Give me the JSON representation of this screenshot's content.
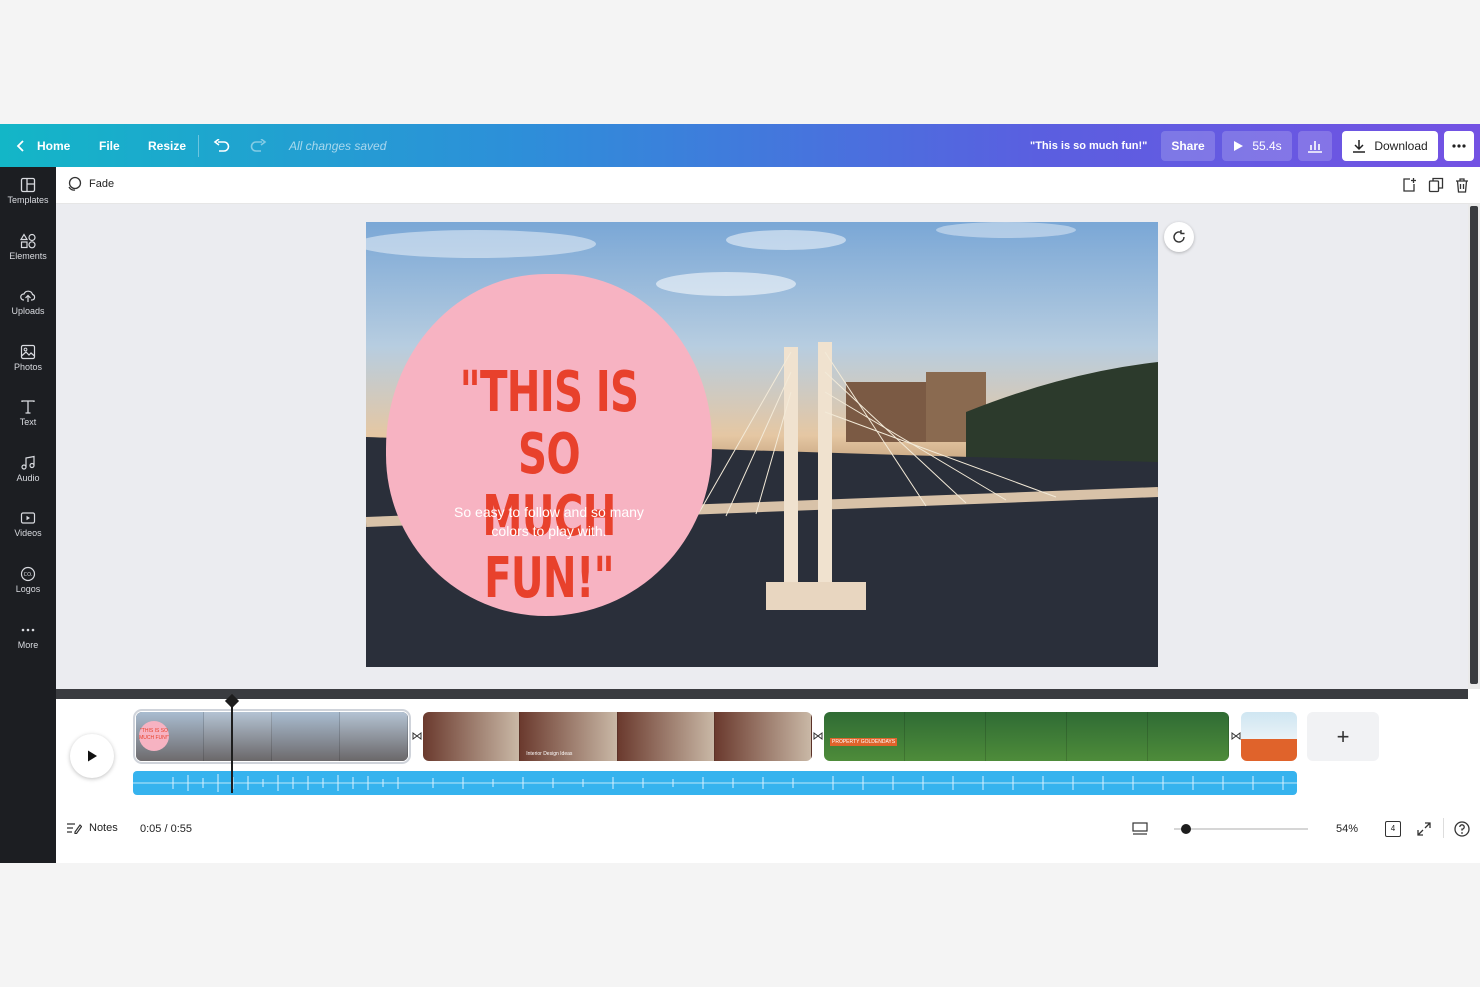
{
  "topbar": {
    "home": "Home",
    "file": "File",
    "resize": "Resize",
    "save_status": "All changes saved",
    "design_title": "\"This is so much fun!\"",
    "share": "Share",
    "duration": "55.4s",
    "download": "Download"
  },
  "sidebar": {
    "items": [
      {
        "label": "Templates",
        "icon": "templates-icon"
      },
      {
        "label": "Elements",
        "icon": "elements-icon"
      },
      {
        "label": "Uploads",
        "icon": "uploads-icon"
      },
      {
        "label": "Photos",
        "icon": "photos-icon"
      },
      {
        "label": "Text",
        "icon": "text-icon"
      },
      {
        "label": "Audio",
        "icon": "audio-icon"
      },
      {
        "label": "Videos",
        "icon": "videos-icon"
      },
      {
        "label": "Logos",
        "icon": "logos-icon"
      },
      {
        "label": "More",
        "icon": "more-icon"
      }
    ]
  },
  "toolbar": {
    "animation": "Fade"
  },
  "slide": {
    "headline_line1": "\"THIS IS SO",
    "headline_line2": "MUCH FUN!\"",
    "subtext": "So easy to follow and so many colors to play with."
  },
  "timeline": {
    "clip1_label": "\"THIS IS SO MUCH FUN!\"",
    "clip2_label": "Interior Design Ideas",
    "clip3_label": "PROPERTY GOLDENDAYS"
  },
  "footer": {
    "notes": "Notes",
    "time": "0:05 / 0:55",
    "zoom": "54%",
    "page_count": "4",
    "zoom_level": 0.09
  },
  "colors": {
    "accent_pink": "#f7b3c2",
    "headline_red": "#e8412c",
    "audio_blue": "#36b3ee"
  }
}
